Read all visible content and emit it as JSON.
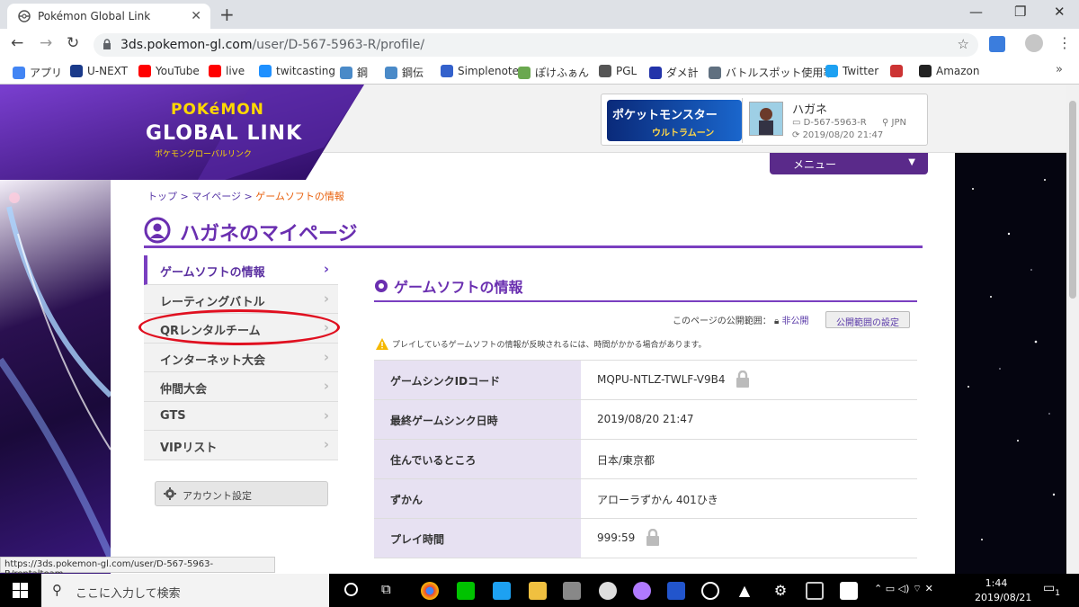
{
  "browser": {
    "tab_title": "Pokémon Global Link",
    "url_host": "3ds.pokemon-gl.com",
    "url_path": "/user/D-567-5963-R/profile/"
  },
  "bookmarks": [
    {
      "label": "アプリ",
      "color": "#4285f4"
    },
    {
      "label": "U-NEXT",
      "color": "#1a3a8a"
    },
    {
      "label": "YouTube",
      "color": "#ff0000"
    },
    {
      "label": "live",
      "color": "#ff0000"
    },
    {
      "label": "twitcasting",
      "color": "#1e90ff"
    },
    {
      "label": "鋼",
      "color": "#4a8ac8"
    },
    {
      "label": "鋼伝",
      "color": "#4a8ac8"
    },
    {
      "label": "Simplenote",
      "color": "#3361cc"
    },
    {
      "label": "ぽけふぁん",
      "color": "#6aa84f"
    },
    {
      "label": "PGL",
      "color": "#555555"
    },
    {
      "label": "ダメ計",
      "color": "#2233aa"
    },
    {
      "label": "バトルスポット使用率",
      "color": "#607080"
    },
    {
      "label": "Twitter",
      "color": "#1da1f2"
    },
    {
      "label": "",
      "color": "#cc3333"
    },
    {
      "label": "Amazon",
      "color": "#222222"
    }
  ],
  "header": {
    "logo_top": "POKéMON",
    "logo_main": "GLOBAL LINK",
    "logo_sub": "ポケモングローバルリンク",
    "game_title": "ポケットモンスター",
    "game_subtitle": "ウルトラムーン",
    "player_name": "ハガネ",
    "player_id": "D-567-5963-R",
    "player_country": "JPN",
    "player_date": "2019/08/20 21:47",
    "menu_label": "メニュー"
  },
  "breadcrumb": {
    "top": "トップ",
    "mypage": "マイページ",
    "current": "ゲームソフトの情報",
    "sep": ">"
  },
  "page_title": "ハガネのマイページ",
  "sidenav": [
    {
      "label": "ゲームソフトの情報",
      "active": true
    },
    {
      "label": "レーティングバトル",
      "active": false
    },
    {
      "label": "QRレンタルチーム",
      "active": false
    },
    {
      "label": "インターネット大会",
      "active": false
    },
    {
      "label": "仲間大会",
      "active": false
    },
    {
      "label": "GTS",
      "active": false
    },
    {
      "label": "VIPリスト",
      "active": false
    }
  ],
  "account_button": "アカウント設定",
  "section": {
    "title": "ゲームソフトの情報",
    "visibility_label": "このページの公開範囲：",
    "visibility_value": "非公開",
    "visibility_button": "公開範囲の設定",
    "warning": "プレイしているゲームソフトの情報が反映されるには、時間がかかる場合があります。"
  },
  "rows": [
    {
      "key": "ゲームシンクIDコード",
      "value": "MQPU-NTLZ-TWLF-V9B4"
    },
    {
      "key": "最終ゲームシンク日時",
      "value": "2019/08/20 21:47"
    },
    {
      "key": "住んでいるところ",
      "value": "日本/東京都"
    },
    {
      "key": "ずかん",
      "value": "アローラずかん 401ひき"
    },
    {
      "key": "プレイ時間",
      "value": "999:59"
    }
  ],
  "status_url": "https://3ds.pokemon-gl.com/user/D-567-5963-R/rentalteam",
  "taskbar": {
    "search_placeholder": "ここに入力して検索",
    "time": "1:44",
    "date": "2019/08/21",
    "notification_count": "1"
  },
  "colors": {
    "accent_purple": "#7a3fc0",
    "highlight_red": "#e01020",
    "breadcrumb_orange": "#e8600c"
  }
}
